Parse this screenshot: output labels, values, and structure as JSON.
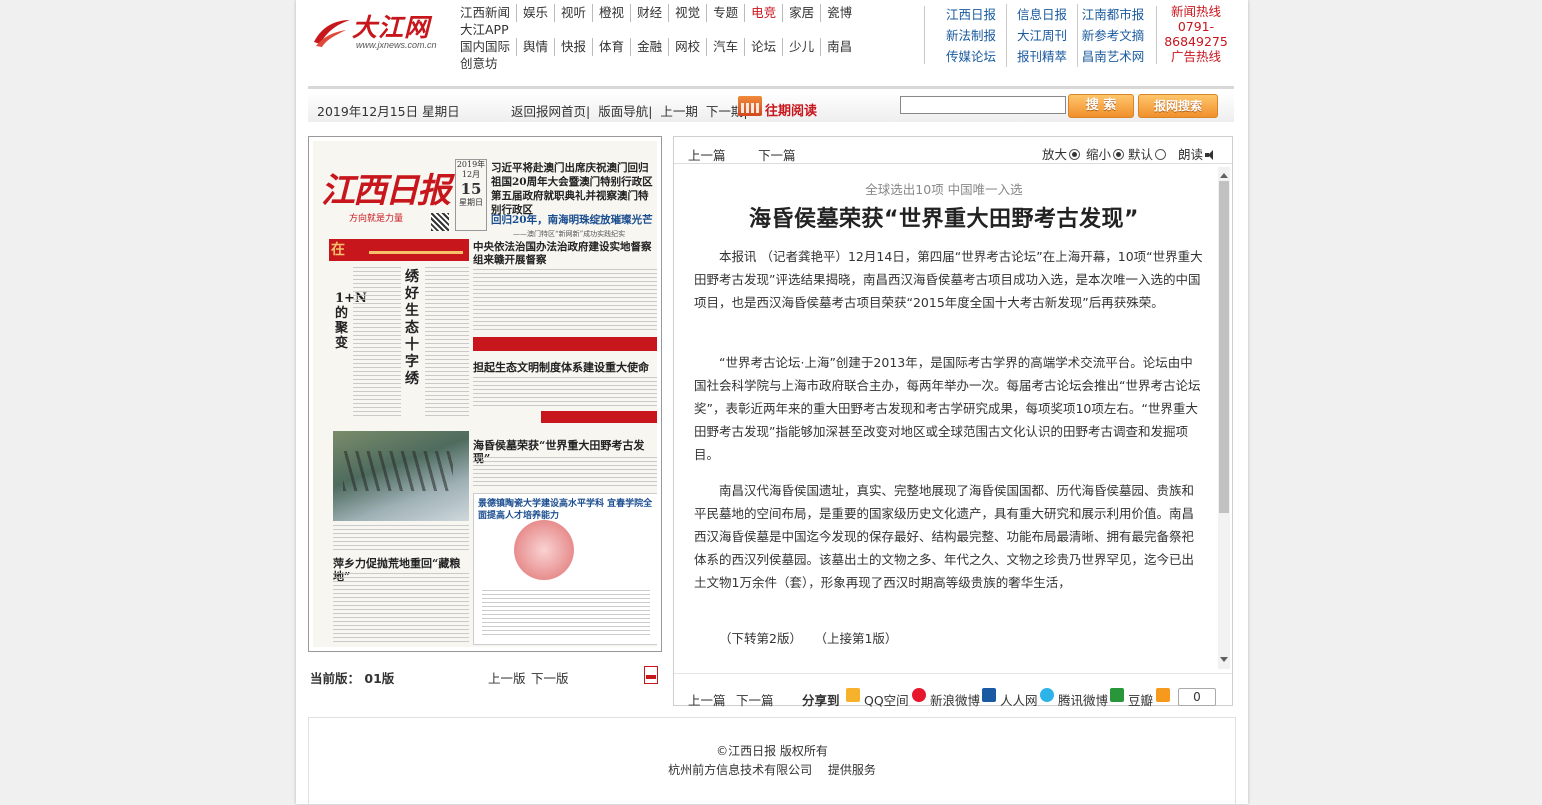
{
  "logo": {
    "name": "大江网",
    "url": "www.jxnews.com.cn"
  },
  "channels": {
    "row1": [
      "江西新闻",
      "娱乐",
      "视听",
      "橙视",
      "财经",
      "视觉",
      "专题",
      "电竞",
      "家居",
      "瓷博"
    ],
    "row1_sub": "大江APP",
    "row2": [
      "国内国际",
      "舆情",
      "快报",
      "体育",
      "金融",
      "网校",
      "汽车",
      "论坛",
      "少儿",
      "南昌"
    ],
    "row2_sub": "创意坊"
  },
  "papers": [
    [
      "江西日报",
      "信息日报",
      "江南都市报"
    ],
    [
      "新法制报",
      "大江周刊",
      "新参考文摘"
    ],
    [
      "传媒论坛",
      "报刊精萃",
      "昌南艺术网"
    ]
  ],
  "hotline": {
    "l1": "新闻热线",
    "l2": "0791-",
    "l3": "86849275",
    "l4": "广告热线"
  },
  "navbar": {
    "date": "2019年12月15日 星期日",
    "home": "返回报网首页|",
    "page_nav": "版面导航|",
    "prev": "上一期",
    "next": "下一期|",
    "past": "往期阅读",
    "search_btn": "搜 索",
    "paper_search_btn": "报网搜索"
  },
  "newspaper": {
    "masthead": "江西日报",
    "slogan": "方向就是力量",
    "date_top": "2019年12月",
    "date_day": "15",
    "date_week": "星期日",
    "headline1": "习近平将赴澳门出席庆祝澳门回归祖国20周年大会暨澳门特别行政区第五届政府就职典礼并视察澳门特别行政区",
    "headline2": "回归20年，南海明珠绽放璀璨光芒",
    "headline2_sub": "——澳门特区“新网新”成功实践纪实",
    "zai": "在",
    "headline3": "中央依法治国办法治政府建设实地督察组来赣开展督察",
    "vtitle1": "1+N的聚变",
    "vtitle2": "绣好生态十字绣",
    "headline4": "担起生态文明制度体系建设重大使命",
    "headline5": "海昏侯墓荣获“世界重大田野考古发现”",
    "headline6": "萍乡力促抛荒地重回“藏粮地”",
    "ad_title": "景德镇陶瓷大学建设高水平学科 宜春学院全面提高人才培养能力"
  },
  "left_footer": {
    "current_label": "当前版：",
    "current": "01版",
    "prev": "上一版",
    "next": "下一版"
  },
  "article": {
    "toolbar": {
      "prev": "上一篇",
      "next": "下一篇",
      "zoom_in": "放大",
      "zoom_out": "缩小",
      "default": "默认",
      "read": "朗读"
    },
    "subtitle": "全球选出10项 中国唯一入选",
    "title": "海昏侯墓荣获“世界重大田野考古发现”",
    "paragraphs": [
      "本报讯 （记者龚艳平）12月14日，第四届“世界考古论坛”在上海开幕，10项“世界重大田野考古发现”评选结果揭晓，南昌西汉海昏侯墓考古项目成功入选，是本次唯一入选的中国项目，也是西汉海昏侯墓考古项目荣获“2015年度全国十大考古新发现”后再获殊荣。",
      "“世界考古论坛·上海”创建于2013年，是国际考古学界的高端学术交流平台。论坛由中国社会科学院与上海市政府联合主办，每两年举办一次。每届考古论坛会推出“世界考古论坛奖”，表彰近两年来的重大田野考古发现和考古学研究成果，每项奖项10项左右。“世界重大田野考古发现”指能够加深甚至改变对地区或全球范围古文化认识的田野考古调查和发掘项目。",
      "南昌汉代海昏侯国遗址，真实、完整地展现了海昏侯国国都、历代海昏侯墓园、贵族和平民墓地的空间布局，是重要的国家级历史文化遗产，具有重大研究和展示利用价值。南昌西汉海昏侯墓是中国迄今发现的保存最好、结构最完整、功能布局最清晰、拥有最完备祭祀体系的西汉列侯墓园。该墓出土的文物之多、年代之久、文物之珍贵乃世界罕见，迄今已出土文物1万余件（套），形象再现了西汉时期高等级贵族的奢华生活，",
      "（下转第2版）　　（上接第1版）"
    ],
    "footer": {
      "prev": "上一篇",
      "next": "下一篇",
      "share": "分享到",
      "qq": "QQ空间",
      "weibo": "新浪微博",
      "renren": "人人网",
      "tencent": "腾讯微博",
      "douban": "豆瓣",
      "count": "0"
    }
  },
  "footer": {
    "copyright": "©江西日报 版权所有",
    "service": "杭州前方信息技术有限公司　 提供服务"
  },
  "colors": {
    "accent_red": "#c8161d",
    "link_blue": "#1a5a9e",
    "button_orange": "#f0902c"
  }
}
